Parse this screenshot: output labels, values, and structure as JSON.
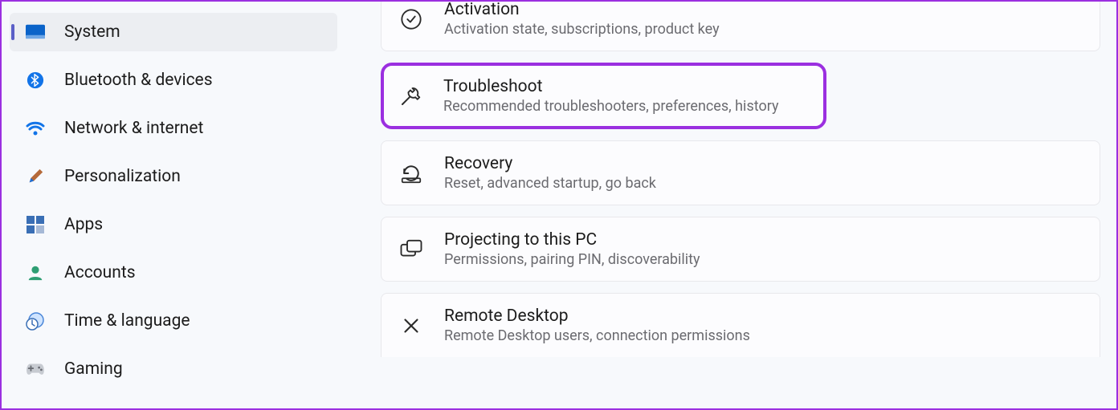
{
  "sidebar": {
    "items": [
      {
        "label": "System"
      },
      {
        "label": "Bluetooth & devices"
      },
      {
        "label": "Network & internet"
      },
      {
        "label": "Personalization"
      },
      {
        "label": "Apps"
      },
      {
        "label": "Accounts"
      },
      {
        "label": "Time & language"
      },
      {
        "label": "Gaming"
      }
    ]
  },
  "main": {
    "cards": [
      {
        "title": "Activation",
        "desc": "Activation state, subscriptions, product key"
      },
      {
        "title": "Troubleshoot",
        "desc": "Recommended troubleshooters, preferences, history"
      },
      {
        "title": "Recovery",
        "desc": "Reset, advanced startup, go back"
      },
      {
        "title": "Projecting to this PC",
        "desc": "Permissions, pairing PIN, discoverability"
      },
      {
        "title": "Remote Desktop",
        "desc": "Remote Desktop users, connection permissions"
      }
    ]
  },
  "highlight_color": "#9b2fe0"
}
